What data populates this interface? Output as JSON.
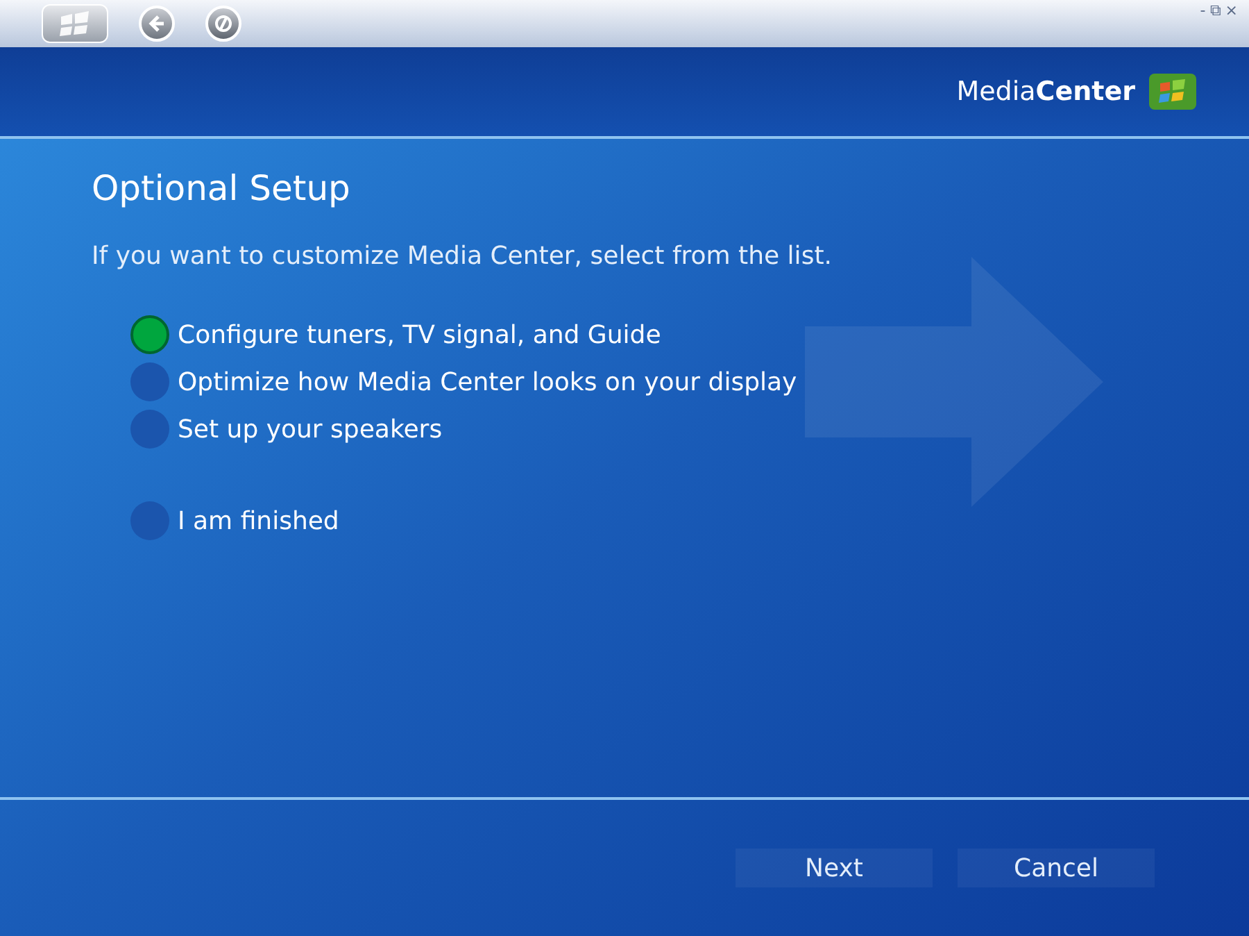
{
  "window": {
    "controls": [
      "-",
      "⧉",
      "×"
    ]
  },
  "logo": {
    "text": "Media**Center**"
  },
  "page": {
    "title": "Optional Setup",
    "instruction": "If you want to customize Media Center, select from the list."
  },
  "options": [
    {
      "label": "Configure tuners, TV signal, and Guide",
      "selected": true
    },
    {
      "label": "Optimize how Media Center looks on your display",
      "selected": false
    },
    {
      "label": "Set up your speakers",
      "selected": false
    }
  ],
  "finish_option": {
    "label": "I am finished",
    "selected": false
  },
  "buttons": [
    {
      "label": "Next"
    },
    {
      "label": "Cancel"
    }
  ]
}
